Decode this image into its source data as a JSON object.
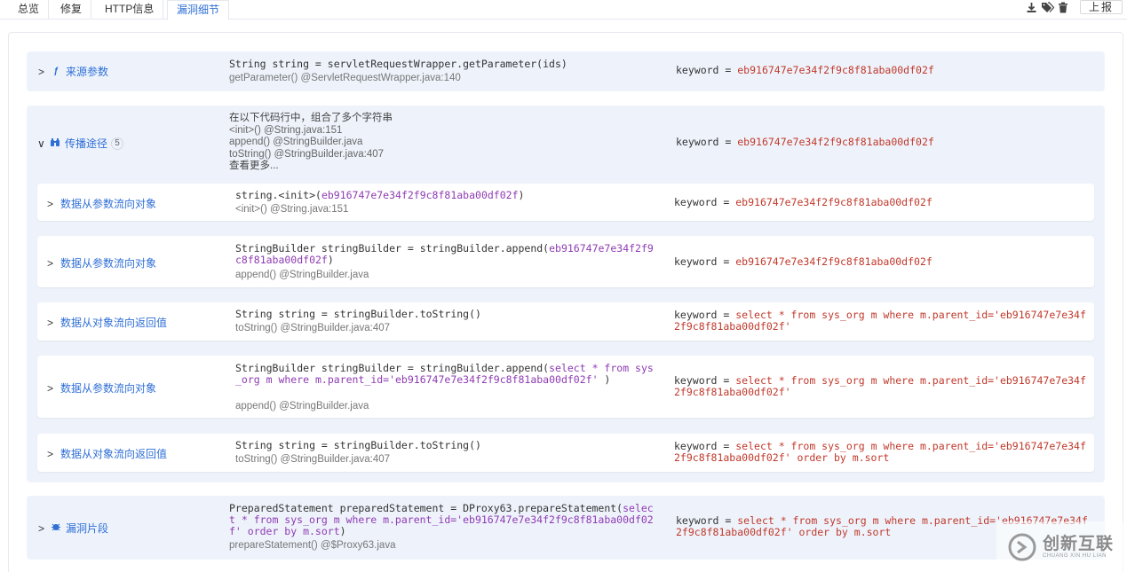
{
  "tabs": [
    {
      "label": "总览",
      "active": false
    },
    {
      "label": "修复",
      "active": false
    },
    {
      "label": "HTTP信息",
      "active": false
    },
    {
      "label": "漏洞细节",
      "active": true
    }
  ],
  "toolbar": {
    "icons": [
      "download-icon",
      "tags-icon",
      "trash-icon"
    ],
    "report_label": "上报"
  },
  "source": {
    "label": "来源参数",
    "icon": "function-icon",
    "code": "String string = servletRequestWrapper.getParameter(ids)",
    "location": "getParameter() @ServletRequestWrapper.java:140",
    "kw_prefix": "keyword = ",
    "kw_value": "eb916747e7e34f2f9c8f81aba00df02f"
  },
  "propagation": {
    "label": "传播途径",
    "icon": "binoculars-icon",
    "count": "5",
    "summary": [
      "在以下代码行中，组合了多个字符串",
      "<init>() @String.java:151",
      "append() @StringBuilder.java",
      "toString() @StringBuilder.java:407",
      "查看更多..."
    ],
    "kw_prefix": "keyword = ",
    "kw_value": "eb916747e7e34f2f9c8f81aba00df02f",
    "rows": [
      {
        "label": "数据从参数流向对象",
        "code_pre": "string.<init>(",
        "code_hl": "eb916747e7e34f2f9c8f81aba00df02f",
        "code_post": ")",
        "location": "<init>() @String.java:151",
        "kw_prefix": "keyword = ",
        "kw_value": "eb916747e7e34f2f9c8f81aba00df02f"
      },
      {
        "label": "数据从参数流向对象",
        "code_pre": "StringBuilder stringBuilder = stringBuilder.append(",
        "code_hl": "eb916747e7e34f2f9c8f81aba00df02f",
        "code_post": ")",
        "location": "append() @StringBuilder.java",
        "kw_prefix": "keyword = ",
        "kw_value": "eb916747e7e34f2f9c8f81aba00df02f"
      },
      {
        "label": "数据从对象流向返回值",
        "code_pre": "String string = stringBuilder.toString()",
        "location": "toString() @StringBuilder.java:407",
        "kw_prefix": "keyword = ",
        "kw_value": "select * from sys_org m where m.parent_id='eb916747e7e34f2f9c8f81aba00df02f'"
      },
      {
        "label": "数据从参数流向对象",
        "code_pre": "StringBuilder stringBuilder = stringBuilder.append(",
        "code_hl": "select * from sys_org m where m.parent_id='eb916747e7e34f2f9c8f81aba00df02f' ",
        "code_post": ")",
        "location": "append() @StringBuilder.java",
        "kw_prefix": "keyword = ",
        "kw_value": "select * from sys_org m where m.parent_id='eb916747e7e34f2f9c8f81aba00df02f'"
      },
      {
        "label": "数据从对象流向返回值",
        "code_pre": "String string = stringBuilder.toString()",
        "location": "toString() @StringBuilder.java:407",
        "kw_prefix": "keyword = ",
        "kw_value": "select * from sys_org m where m.parent_id='eb916747e7e34f2f9c8f81aba00df02f' order by m.sort"
      }
    ]
  },
  "sink": {
    "label": "漏洞片段",
    "icon": "bug-icon",
    "code_pre": "PreparedStatement preparedStatement = DProxy63.prepareStatement(",
    "code_hl": "select * from sys_org m where m.parent_id='eb916747e7e34f2f9c8f81aba00df02f' order by m.sort",
    "code_post": ")",
    "location": "prepareStatement() @$Proxy63.java",
    "kw_prefix": "keyword = ",
    "kw_value": "select * from sys_org m where m.parent_id='eb916747e7e34f2f9c8f81aba00df02f' order by m.sort"
  },
  "watermark": {
    "cn": "创新互联",
    "en": "CHUANG XIN HU LIAN"
  },
  "colors": {
    "accent": "#2f6fd6",
    "tainted": "#c0392b",
    "highlight": "#8e3bb3",
    "panel": "#eef3fb"
  }
}
